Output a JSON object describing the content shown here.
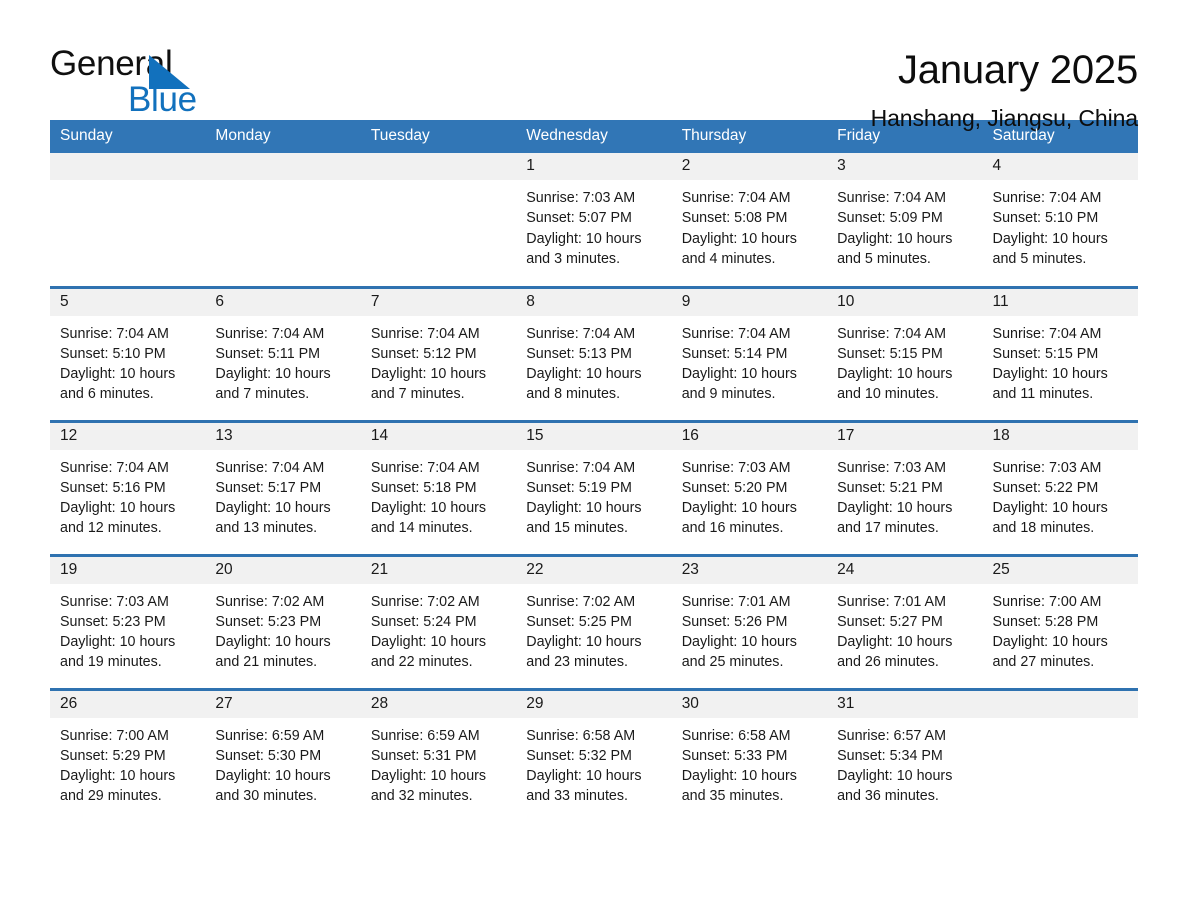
{
  "logo": {
    "word_one": "General",
    "word_two": "Blue",
    "triangle_color": "#1271bd"
  },
  "header": {
    "title": "January 2025",
    "location": "Hanshang, Jiangsu, China",
    "accent_color": "#3176b6",
    "row_border_color": "#2f72b0",
    "daynum_band_color": "#f1f1f1"
  },
  "weekday_headers": [
    "Sunday",
    "Monday",
    "Tuesday",
    "Wednesday",
    "Thursday",
    "Friday",
    "Saturday"
  ],
  "labels": {
    "sunrise_prefix": "Sunrise:",
    "sunset_prefix": "Sunset:",
    "daylight_prefix": "Daylight:"
  },
  "weeks": [
    [
      {
        "day": "",
        "empty": true
      },
      {
        "day": "",
        "empty": true
      },
      {
        "day": "",
        "empty": true
      },
      {
        "day": "1",
        "sunrise": "Sunrise: 7:03 AM",
        "sunset": "Sunset: 5:07 PM",
        "daylight_line1": "Daylight: 10 hours",
        "daylight_line2": "and 3 minutes."
      },
      {
        "day": "2",
        "sunrise": "Sunrise: 7:04 AM",
        "sunset": "Sunset: 5:08 PM",
        "daylight_line1": "Daylight: 10 hours",
        "daylight_line2": "and 4 minutes."
      },
      {
        "day": "3",
        "sunrise": "Sunrise: 7:04 AM",
        "sunset": "Sunset: 5:09 PM",
        "daylight_line1": "Daylight: 10 hours",
        "daylight_line2": "and 5 minutes."
      },
      {
        "day": "4",
        "sunrise": "Sunrise: 7:04 AM",
        "sunset": "Sunset: 5:10 PM",
        "daylight_line1": "Daylight: 10 hours",
        "daylight_line2": "and 5 minutes."
      }
    ],
    [
      {
        "day": "5",
        "sunrise": "Sunrise: 7:04 AM",
        "sunset": "Sunset: 5:10 PM",
        "daylight_line1": "Daylight: 10 hours",
        "daylight_line2": "and 6 minutes."
      },
      {
        "day": "6",
        "sunrise": "Sunrise: 7:04 AM",
        "sunset": "Sunset: 5:11 PM",
        "daylight_line1": "Daylight: 10 hours",
        "daylight_line2": "and 7 minutes."
      },
      {
        "day": "7",
        "sunrise": "Sunrise: 7:04 AM",
        "sunset": "Sunset: 5:12 PM",
        "daylight_line1": "Daylight: 10 hours",
        "daylight_line2": "and 7 minutes."
      },
      {
        "day": "8",
        "sunrise": "Sunrise: 7:04 AM",
        "sunset": "Sunset: 5:13 PM",
        "daylight_line1": "Daylight: 10 hours",
        "daylight_line2": "and 8 minutes."
      },
      {
        "day": "9",
        "sunrise": "Sunrise: 7:04 AM",
        "sunset": "Sunset: 5:14 PM",
        "daylight_line1": "Daylight: 10 hours",
        "daylight_line2": "and 9 minutes."
      },
      {
        "day": "10",
        "sunrise": "Sunrise: 7:04 AM",
        "sunset": "Sunset: 5:15 PM",
        "daylight_line1": "Daylight: 10 hours",
        "daylight_line2": "and 10 minutes."
      },
      {
        "day": "11",
        "sunrise": "Sunrise: 7:04 AM",
        "sunset": "Sunset: 5:15 PM",
        "daylight_line1": "Daylight: 10 hours",
        "daylight_line2": "and 11 minutes."
      }
    ],
    [
      {
        "day": "12",
        "sunrise": "Sunrise: 7:04 AM",
        "sunset": "Sunset: 5:16 PM",
        "daylight_line1": "Daylight: 10 hours",
        "daylight_line2": "and 12 minutes."
      },
      {
        "day": "13",
        "sunrise": "Sunrise: 7:04 AM",
        "sunset": "Sunset: 5:17 PM",
        "daylight_line1": "Daylight: 10 hours",
        "daylight_line2": "and 13 minutes."
      },
      {
        "day": "14",
        "sunrise": "Sunrise: 7:04 AM",
        "sunset": "Sunset: 5:18 PM",
        "daylight_line1": "Daylight: 10 hours",
        "daylight_line2": "and 14 minutes."
      },
      {
        "day": "15",
        "sunrise": "Sunrise: 7:04 AM",
        "sunset": "Sunset: 5:19 PM",
        "daylight_line1": "Daylight: 10 hours",
        "daylight_line2": "and 15 minutes."
      },
      {
        "day": "16",
        "sunrise": "Sunrise: 7:03 AM",
        "sunset": "Sunset: 5:20 PM",
        "daylight_line1": "Daylight: 10 hours",
        "daylight_line2": "and 16 minutes."
      },
      {
        "day": "17",
        "sunrise": "Sunrise: 7:03 AM",
        "sunset": "Sunset: 5:21 PM",
        "daylight_line1": "Daylight: 10 hours",
        "daylight_line2": "and 17 minutes."
      },
      {
        "day": "18",
        "sunrise": "Sunrise: 7:03 AM",
        "sunset": "Sunset: 5:22 PM",
        "daylight_line1": "Daylight: 10 hours",
        "daylight_line2": "and 18 minutes."
      }
    ],
    [
      {
        "day": "19",
        "sunrise": "Sunrise: 7:03 AM",
        "sunset": "Sunset: 5:23 PM",
        "daylight_line1": "Daylight: 10 hours",
        "daylight_line2": "and 19 minutes."
      },
      {
        "day": "20",
        "sunrise": "Sunrise: 7:02 AM",
        "sunset": "Sunset: 5:23 PM",
        "daylight_line1": "Daylight: 10 hours",
        "daylight_line2": "and 21 minutes."
      },
      {
        "day": "21",
        "sunrise": "Sunrise: 7:02 AM",
        "sunset": "Sunset: 5:24 PM",
        "daylight_line1": "Daylight: 10 hours",
        "daylight_line2": "and 22 minutes."
      },
      {
        "day": "22",
        "sunrise": "Sunrise: 7:02 AM",
        "sunset": "Sunset: 5:25 PM",
        "daylight_line1": "Daylight: 10 hours",
        "daylight_line2": "and 23 minutes."
      },
      {
        "day": "23",
        "sunrise": "Sunrise: 7:01 AM",
        "sunset": "Sunset: 5:26 PM",
        "daylight_line1": "Daylight: 10 hours",
        "daylight_line2": "and 25 minutes."
      },
      {
        "day": "24",
        "sunrise": "Sunrise: 7:01 AM",
        "sunset": "Sunset: 5:27 PM",
        "daylight_line1": "Daylight: 10 hours",
        "daylight_line2": "and 26 minutes."
      },
      {
        "day": "25",
        "sunrise": "Sunrise: 7:00 AM",
        "sunset": "Sunset: 5:28 PM",
        "daylight_line1": "Daylight: 10 hours",
        "daylight_line2": "and 27 minutes."
      }
    ],
    [
      {
        "day": "26",
        "sunrise": "Sunrise: 7:00 AM",
        "sunset": "Sunset: 5:29 PM",
        "daylight_line1": "Daylight: 10 hours",
        "daylight_line2": "and 29 minutes."
      },
      {
        "day": "27",
        "sunrise": "Sunrise: 6:59 AM",
        "sunset": "Sunset: 5:30 PM",
        "daylight_line1": "Daylight: 10 hours",
        "daylight_line2": "and 30 minutes."
      },
      {
        "day": "28",
        "sunrise": "Sunrise: 6:59 AM",
        "sunset": "Sunset: 5:31 PM",
        "daylight_line1": "Daylight: 10 hours",
        "daylight_line2": "and 32 minutes."
      },
      {
        "day": "29",
        "sunrise": "Sunrise: 6:58 AM",
        "sunset": "Sunset: 5:32 PM",
        "daylight_line1": "Daylight: 10 hours",
        "daylight_line2": "and 33 minutes."
      },
      {
        "day": "30",
        "sunrise": "Sunrise: 6:58 AM",
        "sunset": "Sunset: 5:33 PM",
        "daylight_line1": "Daylight: 10 hours",
        "daylight_line2": "and 35 minutes."
      },
      {
        "day": "31",
        "sunrise": "Sunrise: 6:57 AM",
        "sunset": "Sunset: 5:34 PM",
        "daylight_line1": "Daylight: 10 hours",
        "daylight_line2": "and 36 minutes."
      },
      {
        "day": "",
        "empty": true
      }
    ]
  ]
}
